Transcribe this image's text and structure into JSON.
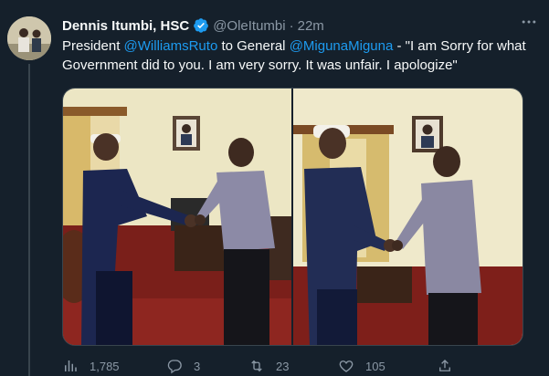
{
  "tweet": {
    "author_name": "Dennis Itumbi, HSC",
    "handle": "@OleItumbi",
    "separator": "·",
    "time": "22m",
    "text_prefix": "President ",
    "mention_1": "@WilliamsRuto",
    "text_middle": " to General ",
    "mention_2": "@MigunaMiguna",
    "text_suffix": " - \"I am Sorry for what Government did to you. I am very sorry. It was unfair. I apologize\""
  },
  "actions": {
    "views": "1,785",
    "replies": "3",
    "retweets": "23",
    "likes": "105"
  },
  "icons": {
    "verified": "verified-badge-icon",
    "more": "more-options-icon",
    "views": "analytics-icon",
    "reply": "reply-icon",
    "retweet": "retweet-icon",
    "like": "heart-icon",
    "share": "share-icon"
  },
  "colors": {
    "background": "#15202b",
    "text": "#f7f9f9",
    "muted": "#8b98a5",
    "accent": "#1d9bf0"
  }
}
